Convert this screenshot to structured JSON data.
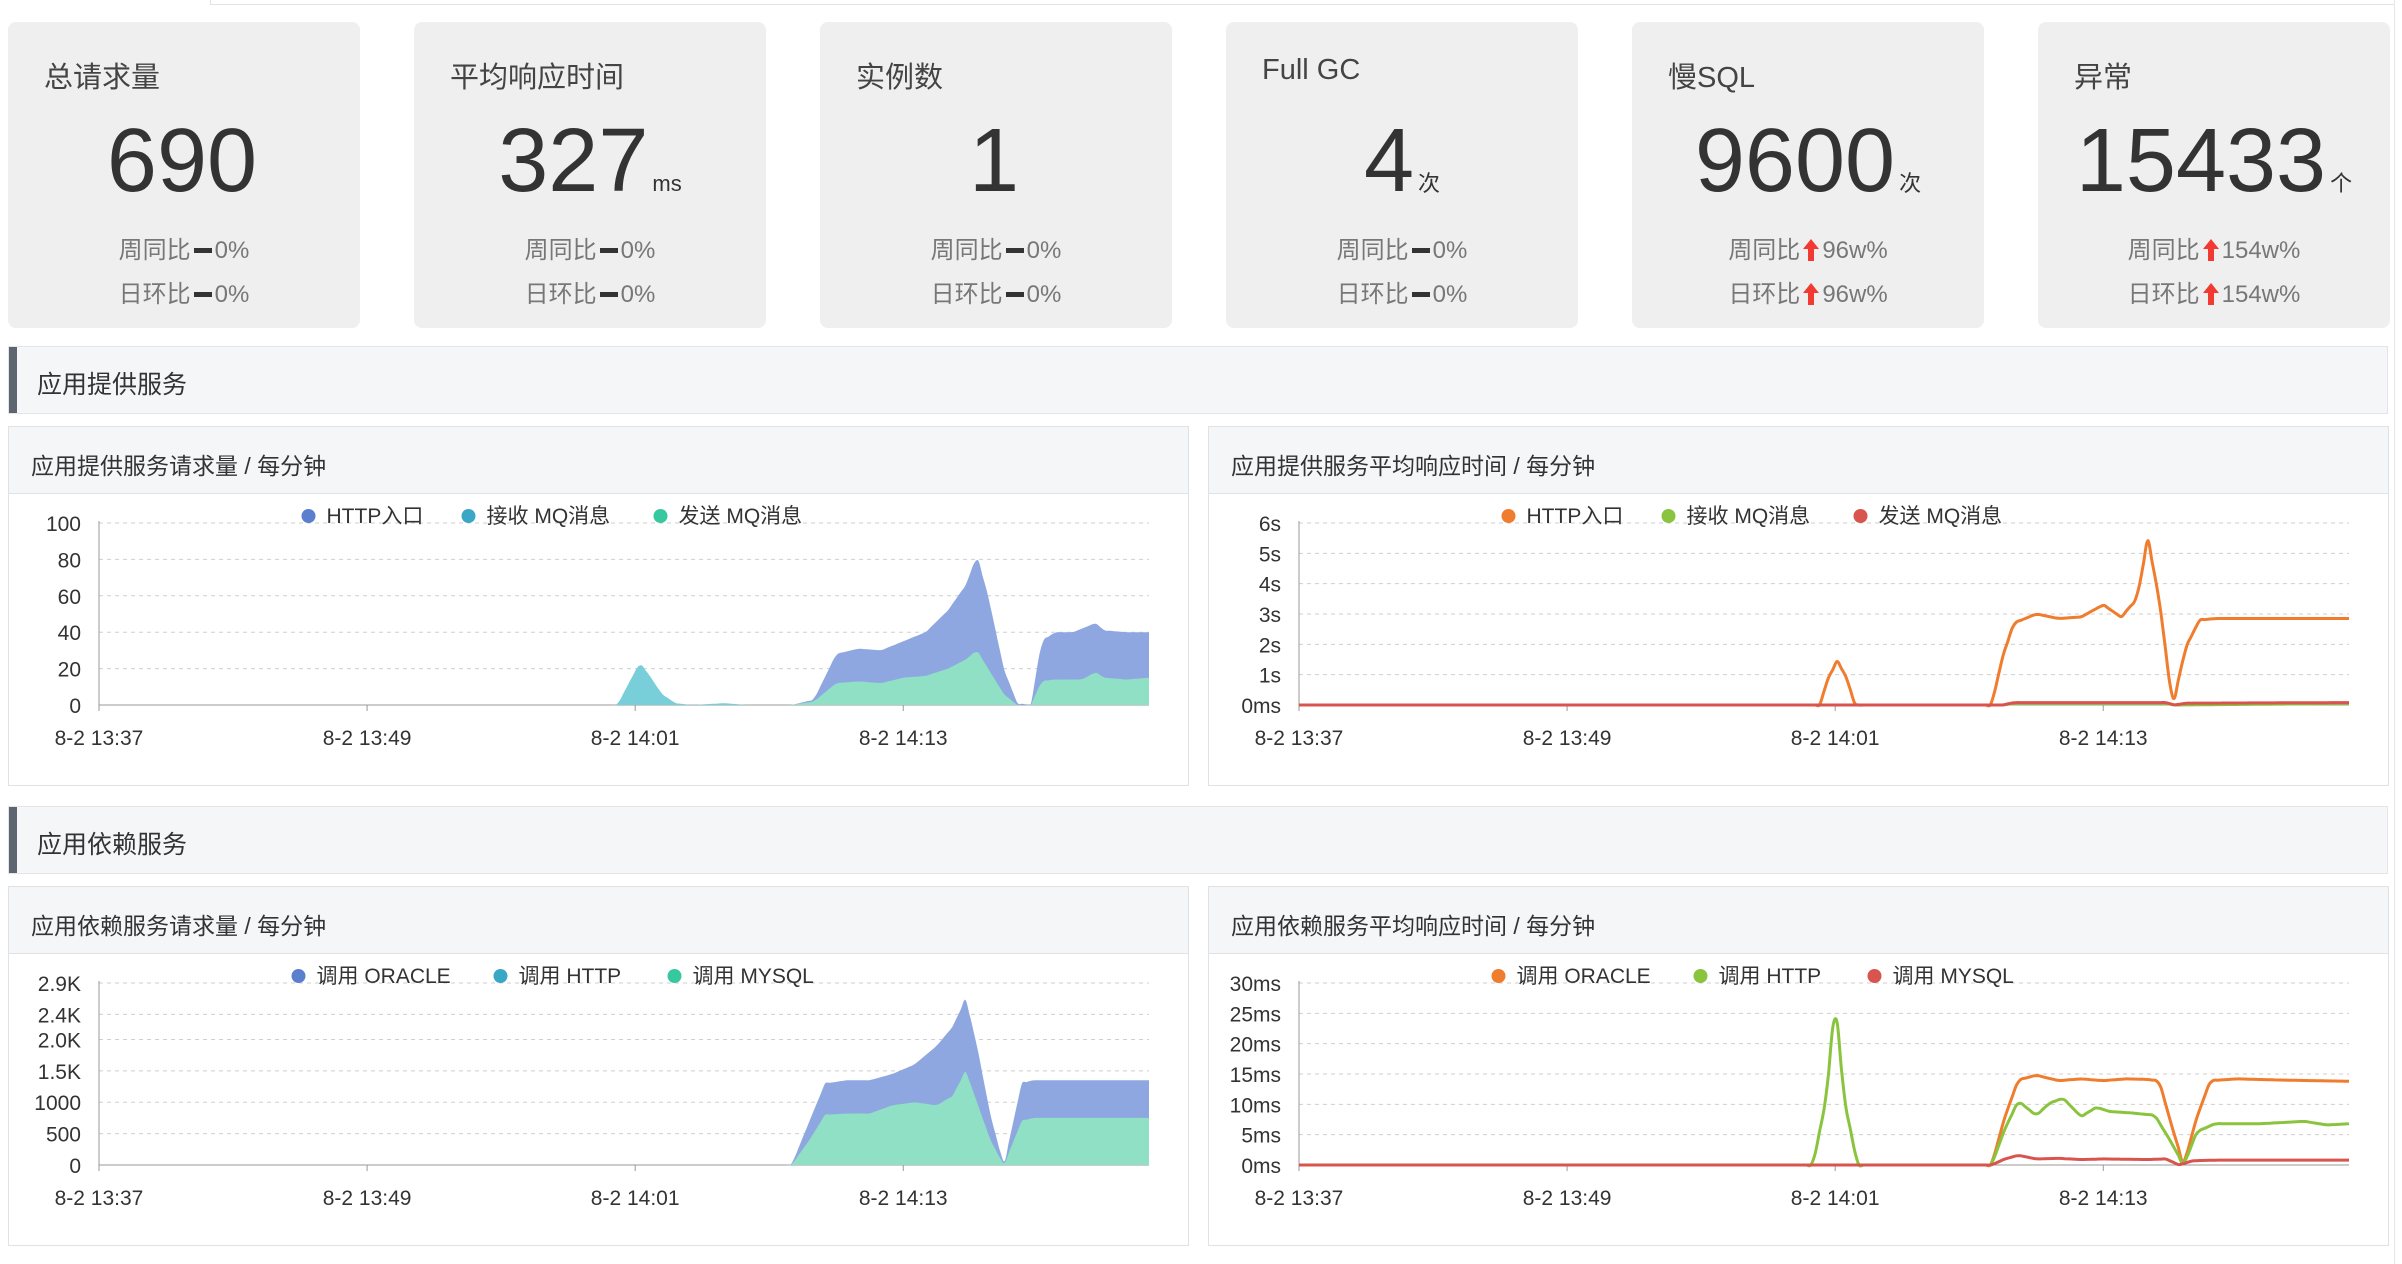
{
  "kpis": [
    {
      "title": "总请求量",
      "value": "690",
      "unit": "",
      "week_label": "周同比",
      "week_trend": "flat",
      "week_value": "0%",
      "day_label": "日环比",
      "day_trend": "flat",
      "day_value": "0%"
    },
    {
      "title": "平均响应时间",
      "value": "327",
      "unit": "ms",
      "week_label": "周同比",
      "week_trend": "flat",
      "week_value": "0%",
      "day_label": "日环比",
      "day_trend": "flat",
      "day_value": "0%"
    },
    {
      "title": "实例数",
      "value": "1",
      "unit": "",
      "week_label": "周同比",
      "week_trend": "flat",
      "week_value": "0%",
      "day_label": "日环比",
      "day_trend": "flat",
      "day_value": "0%"
    },
    {
      "title": "Full GC",
      "value": "4",
      "unit": "次",
      "week_label": "周同比",
      "week_trend": "flat",
      "week_value": "0%",
      "day_label": "日环比",
      "day_trend": "flat",
      "day_value": "0%"
    },
    {
      "title": "慢SQL",
      "value": "9600",
      "unit": "次",
      "week_label": "周同比",
      "week_trend": "up",
      "week_value": "96w%",
      "day_label": "日环比",
      "day_trend": "up",
      "day_value": "96w%"
    },
    {
      "title": "异常",
      "value": "15433",
      "unit": "个",
      "week_label": "周同比",
      "week_trend": "up",
      "week_value": "154w%",
      "day_label": "日环比",
      "day_trend": "up",
      "day_value": "154w%"
    }
  ],
  "colors": {
    "up_arrow": "#f03a32",
    "flat_bar": "#333333"
  },
  "sections": {
    "provided": "应用提供服务",
    "dependent": "应用依赖服务"
  },
  "panels": {
    "p1": {
      "title": "应用提供服务请求量 / 每分钟"
    },
    "p2": {
      "title": "应用提供服务平均响应时间 / 每分钟"
    },
    "p3": {
      "title": "应用依赖服务请求量 / 每分钟"
    },
    "p4": {
      "title": "应用依赖服务平均响应时间 / 每分钟"
    }
  },
  "chart_data": [
    {
      "id": "p1",
      "type": "area",
      "stacked": true,
      "x_tick_labels": [
        "8-2 13:37",
        "8-2 13:49",
        "8-2 14:01",
        "8-2 14:13"
      ],
      "x_range_minutes": [
        0,
        47
      ],
      "x_tick_minutes": [
        0,
        12,
        24,
        36
      ],
      "ylim": [
        0,
        100
      ],
      "y_tick_values": [
        0,
        20,
        40,
        60,
        80,
        100
      ],
      "y_tick_labels": [
        "0",
        "20",
        "40",
        "60",
        "80",
        "100"
      ],
      "legend_position": "top-center",
      "series": [
        {
          "name": "HTTP入口",
          "color": "#5a7fcf",
          "fill": "#8ea7e0",
          "points": [
            [
              0,
              0
            ],
            [
              31,
              0
            ],
            [
              32,
              3
            ],
            [
              33,
              28
            ],
            [
              34,
              31
            ],
            [
              35,
              30
            ],
            [
              36,
              35
            ],
            [
              37,
              40
            ],
            [
              38,
              52
            ],
            [
              38.8,
              66
            ],
            [
              39.3,
              82
            ],
            [
              39.8,
              60
            ],
            [
              40.5,
              20
            ],
            [
              41.1,
              1
            ],
            [
              41.7,
              0
            ],
            [
              42.2,
              35
            ],
            [
              42.8,
              40
            ],
            [
              43.6,
              40
            ],
            [
              44.2,
              43
            ],
            [
              44.6,
              45
            ],
            [
              45,
              41
            ],
            [
              46,
              40
            ],
            [
              47,
              40
            ]
          ]
        },
        {
          "name": "接收 MQ消息",
          "color": "#3ba7c7",
          "fill": "#78cfd9",
          "points": [
            [
              0,
              0
            ],
            [
              23.2,
              0
            ],
            [
              23.8,
              14
            ],
            [
              24.2,
              23
            ],
            [
              24.6,
              17
            ],
            [
              25.2,
              6
            ],
            [
              25.8,
              1
            ],
            [
              26.5,
              0
            ],
            [
              28,
              1
            ],
            [
              29,
              0
            ],
            [
              47,
              0
            ]
          ]
        },
        {
          "name": "发送 MQ消息",
          "color": "#36c9a0",
          "fill": "#8fe0c4",
          "points": [
            [
              0,
              0
            ],
            [
              31,
              0
            ],
            [
              32,
              2
            ],
            [
              33,
              12
            ],
            [
              34,
              13
            ],
            [
              35,
              12
            ],
            [
              36,
              15
            ],
            [
              37,
              16
            ],
            [
              38,
              20
            ],
            [
              38.8,
              25
            ],
            [
              39.3,
              30
            ],
            [
              39.8,
              20
            ],
            [
              40.5,
              6
            ],
            [
              41.1,
              0
            ],
            [
              41.7,
              0
            ],
            [
              42.2,
              13
            ],
            [
              42.8,
              14
            ],
            [
              44,
              14
            ],
            [
              44.6,
              18
            ],
            [
              45,
              15
            ],
            [
              46,
              14
            ],
            [
              47,
              15
            ]
          ]
        }
      ]
    },
    {
      "id": "p2",
      "type": "line",
      "x_tick_labels": [
        "8-2 13:37",
        "8-2 13:49",
        "8-2 14:01",
        "8-2 14:13"
      ],
      "x_range_minutes": [
        0,
        47
      ],
      "x_tick_minutes": [
        0,
        12,
        24,
        36
      ],
      "ylim": [
        0,
        6
      ],
      "y_tick_values": [
        0,
        1,
        2,
        3,
        4,
        5,
        6
      ],
      "y_tick_labels": [
        "0ms",
        "1s",
        "2s",
        "3s",
        "4s",
        "5s",
        "6s"
      ],
      "legend_position": "top-center",
      "series": [
        {
          "name": "HTTP入口",
          "color": "#f07c2e",
          "points": [
            [
              0,
              0
            ],
            [
              23.3,
              0
            ],
            [
              23.7,
              0.9
            ],
            [
              24.1,
              1.45
            ],
            [
              24.5,
              0.9
            ],
            [
              24.9,
              0
            ],
            [
              31,
              0
            ],
            [
              31.5,
              1.6
            ],
            [
              32,
              2.7
            ],
            [
              33,
              3.0
            ],
            [
              34,
              2.85
            ],
            [
              35,
              2.9
            ],
            [
              36,
              3.3
            ],
            [
              36.8,
              2.9
            ],
            [
              37.5,
              3.5
            ],
            [
              38,
              5.45
            ],
            [
              38.5,
              3.5
            ],
            [
              39.1,
              0
            ],
            [
              39.7,
              1.9
            ],
            [
              40.3,
              2.8
            ],
            [
              41,
              2.85
            ],
            [
              43,
              2.85
            ],
            [
              45,
              2.85
            ],
            [
              47,
              2.85
            ]
          ]
        },
        {
          "name": "接收 MQ消息",
          "color": "#8ac43f",
          "points": [
            [
              0,
              0
            ],
            [
              31.5,
              0
            ],
            [
              32,
              0.05
            ],
            [
              38.8,
              0.05
            ],
            [
              39.2,
              0
            ],
            [
              47,
              0.05
            ]
          ]
        },
        {
          "name": "发送 MQ消息",
          "color": "#d9534f",
          "points": [
            [
              0,
              0
            ],
            [
              31.5,
              0
            ],
            [
              32,
              0.08
            ],
            [
              38.8,
              0.08
            ],
            [
              39.2,
              0
            ],
            [
              39.7,
              0.06
            ],
            [
              47,
              0.08
            ]
          ]
        }
      ]
    },
    {
      "id": "p3",
      "type": "area",
      "stacked": true,
      "x_tick_labels": [
        "8-2 13:37",
        "8-2 13:49",
        "8-2 14:01",
        "8-2 14:13"
      ],
      "x_range_minutes": [
        0,
        47
      ],
      "x_tick_minutes": [
        0,
        12,
        24,
        36
      ],
      "ylim": [
        0,
        2900
      ],
      "y_tick_values": [
        0,
        500,
        1000,
        1500,
        2000,
        2400,
        2900
      ],
      "y_tick_labels": [
        "0",
        "500",
        "1000",
        "1.5K",
        "2.0K",
        "2.4K",
        "2.9K"
      ],
      "legend_position": "top-center",
      "series": [
        {
          "name": "调用 ORACLE",
          "color": "#5a7fcf",
          "fill": "#8ea7e0",
          "points": [
            [
              0,
              0
            ],
            [
              31,
              0
            ],
            [
              31.8,
              700
            ],
            [
              32.5,
              1300
            ],
            [
              33.5,
              1350
            ],
            [
              34.5,
              1350
            ],
            [
              35.5,
              1450
            ],
            [
              36.5,
              1600
            ],
            [
              37.5,
              1900
            ],
            [
              38.2,
              2200
            ],
            [
              38.8,
              2650
            ],
            [
              39.3,
              1900
            ],
            [
              39.9,
              800
            ],
            [
              40.5,
              0
            ],
            [
              41.3,
              1300
            ],
            [
              41.8,
              1350
            ],
            [
              44,
              1350
            ],
            [
              47,
              1350
            ]
          ]
        },
        {
          "name": "调用 HTTP",
          "color": "#3ba7c7",
          "fill": "#78cfd9",
          "points": [
            [
              0,
              0
            ],
            [
              47,
              0
            ]
          ]
        },
        {
          "name": "调用 MYSQL",
          "color": "#36c9a0",
          "fill": "#8fe0c4",
          "points": [
            [
              0,
              0
            ],
            [
              31,
              0
            ],
            [
              31.8,
              400
            ],
            [
              32.5,
              800
            ],
            [
              33.5,
              820
            ],
            [
              34.5,
              820
            ],
            [
              35.5,
              950
            ],
            [
              36.5,
              1000
            ],
            [
              37.5,
              950
            ],
            [
              38.2,
              1100
            ],
            [
              38.8,
              1500
            ],
            [
              39.3,
              1000
            ],
            [
              39.9,
              400
            ],
            [
              40.5,
              0
            ],
            [
              41.3,
              700
            ],
            [
              41.8,
              750
            ],
            [
              44,
              750
            ],
            [
              47,
              750
            ]
          ]
        }
      ]
    },
    {
      "id": "p4",
      "type": "line",
      "x_tick_labels": [
        "8-2 13:37",
        "8-2 13:49",
        "8-2 14:01",
        "8-2 14:13"
      ],
      "x_range_minutes": [
        0,
        47
      ],
      "x_tick_minutes": [
        0,
        12,
        24,
        36
      ],
      "ylim": [
        0,
        30
      ],
      "y_tick_values": [
        0,
        5,
        10,
        15,
        20,
        25,
        30
      ],
      "y_tick_labels": [
        "0ms",
        "5ms",
        "10ms",
        "15ms",
        "20ms",
        "25ms",
        "30ms"
      ],
      "legend_position": "top-center",
      "series": [
        {
          "name": "调用 ORACLE",
          "color": "#f07c2e",
          "points": [
            [
              0,
              0
            ],
            [
              31,
              0
            ],
            [
              31.6,
              8
            ],
            [
              32.2,
              14
            ],
            [
              33,
              14.8
            ],
            [
              34,
              13.9
            ],
            [
              35,
              14.2
            ],
            [
              36,
              13.9
            ],
            [
              37,
              14.2
            ],
            [
              38,
              14.1
            ],
            [
              38.5,
              13.8
            ],
            [
              39.1,
              6
            ],
            [
              39.6,
              0
            ],
            [
              40.2,
              8
            ],
            [
              40.8,
              13.9
            ],
            [
              42,
              14.2
            ],
            [
              44,
              14
            ],
            [
              47,
              13.8
            ]
          ]
        },
        {
          "name": "调用 HTTP",
          "color": "#8ac43f",
          "points": [
            [
              0,
              0
            ],
            [
              23,
              0
            ],
            [
              23.6,
              11
            ],
            [
              24,
              27
            ],
            [
              24.4,
              11
            ],
            [
              25,
              0
            ],
            [
              31,
              0
            ],
            [
              31.6,
              6
            ],
            [
              32.2,
              10.5
            ],
            [
              33,
              8.2
            ],
            [
              33.6,
              10.2
            ],
            [
              34.2,
              11
            ],
            [
              35,
              8
            ],
            [
              35.7,
              9.5
            ],
            [
              36.3,
              8.8
            ],
            [
              37.2,
              8.6
            ],
            [
              38.3,
              8.2
            ],
            [
              39,
              4
            ],
            [
              39.6,
              0
            ],
            [
              40.2,
              5.5
            ],
            [
              41,
              6.8
            ],
            [
              43,
              6.8
            ],
            [
              45,
              7.2
            ],
            [
              46,
              6.6
            ],
            [
              47,
              6.8
            ]
          ]
        },
        {
          "name": "调用 MYSQL",
          "color": "#d9534f",
          "points": [
            [
              0,
              0
            ],
            [
              31,
              0
            ],
            [
              31.6,
              1
            ],
            [
              32.2,
              1.6
            ],
            [
              33,
              1.0
            ],
            [
              34,
              1.1
            ],
            [
              35,
              0.9
            ],
            [
              36,
              1.0
            ],
            [
              38,
              0.9
            ],
            [
              38.8,
              1.0
            ],
            [
              39.4,
              0
            ],
            [
              40,
              0.7
            ],
            [
              41,
              0.8
            ],
            [
              44,
              0.8
            ],
            [
              47,
              0.8
            ]
          ]
        }
      ]
    }
  ]
}
